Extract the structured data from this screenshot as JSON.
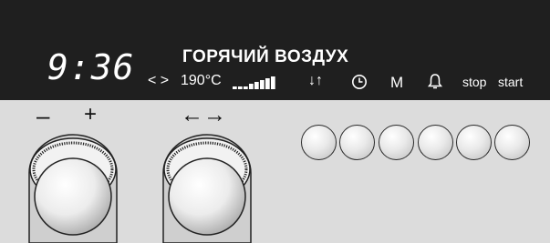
{
  "display": {
    "time": "9:36",
    "mode": "ГОРЯЧИЙ ВОЗДУХ",
    "arrows": "< >",
    "temperature": "190°C",
    "power_level": 5,
    "power_max": 8,
    "updown_icon": "↓↑",
    "timer_icon": "clock-icon",
    "memory": "M",
    "bell_icon": "bell-icon",
    "stop": "stop",
    "start": "start"
  },
  "controls": {
    "minus": "–",
    "plus": "+",
    "direction_arrows": "←→",
    "button_count": 6
  },
  "colors": {
    "display_bg": "#1f1f1f",
    "panel_bg": "#dcdcdc",
    "display_text": "#ffffff"
  }
}
